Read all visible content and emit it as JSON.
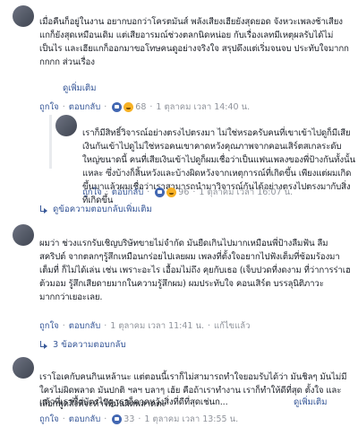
{
  "comments": [
    {
      "id": "c1",
      "text_before": "",
      "text": "เมื่อคืนก็อยู่ในงาน อยากบอกว่าโครตมันส์ พลังเสียงเฮียยังสุดยอด จังหวะเพลงช้าเสียงแกก็ยังสุดเหมือนเดิม แต่เสียอารมณ์ช่วงตลกนิดหน่อย กับเรื่องเลทมีเหตุผลรับได้ไม่เป็นไร และเฮียแกก็ออกมาขอโทษคนดูอย่างจริงใจ สรุปดึงแต่เริ่มจนจบ ประทับใจมากกกกกก ส่วนเรื่อง",
      "see_more": "ดูเพิ่มเติม",
      "like": "ถูกใจ",
      "reply": "ตอบกลับ",
      "reaction_count": "68",
      "time": "1 ตุลาคม เวลา 14:40 น."
    },
    {
      "id": "r1",
      "text": "เราก็มีสิทธิ์วิจารณ์อย่างตรงไปตรงมา ไม่ใช่หรอครับคนที่เขาเข้าไปดูก็มีเสียเงินกันเข้าไปดูไม่ใช่หรอคนเขาคาดหวังคุณภาพจากคอนเสิร์ตสเกลระดับใหญ่ขนาดนี้ คนที่เสียเงินเข้าไปดูก็ผมเชื่อว่าเป็นแฟนเพลงของพี่ป้างกันทั้งนั้นแหละ ซึ่งบ้างก็สิ้นหวังและบ้างผิดหวังจากเหตุการณ์ที่เกิดขึ้น เพียงแต่ผมเกิดขึ้นมาแล้วผมเชื่อว่าเราสามารถนำมาวิจารณ์กันได้อย่างตรงไปตรงมากับสิ่งที่เกิดขึ้น",
      "like": "ถูกใจ",
      "reply": "ตอบกลับ",
      "reaction_count": "96",
      "time": "1 ตุลาคม เวลา 16:07 น."
    },
    {
      "id": "c2",
      "replies_link": "ดูข้อความตอบกลับเพิ่มเติม"
    },
    {
      "id": "c3",
      "text": "ผมว่า ช่วงแรกรับเชิญบริษัทขายไม่จำกัด มันยืดเกินไปมากเหมือนพี่ป้างลืมฟัน ลืมสคริปต์ จากตลกๆรู้สึกเหมือนกร่อยไปเลยผม เพลงที่ตั้งใจอยากไปฟังเต็มที่ซ้อมร้องมาเต็มที่ ก็ไม่ได้เล่น เช่น เพราะอะไร เอื้อมไม่ถึง คุยกับเธอ (เจ็บปวดที่งดงาม ที่ว่าการร่าเฮ ต้วมอม รู้สึกเสียดายมากในความรู้สึกผม) ผมประทับใจ คอนเสิร์ต บรรลุนิติภาวะมากกว่าเยอะเลย.",
      "like": "ถูกใจ",
      "reply": "ตอบกลับ",
      "reaction_count": "",
      "time": "1 ตุลาคม เวลา 11:41 น.",
      "edited": "แก้ไขแล้ว",
      "replies_link": "3 ข้อความตอบกลับ"
    },
    {
      "id": "c4",
      "text": "เราโอเคกับคนกินเหล้านะ แต่ตอนนี้เราก็ไม่สามารถทำใจยอมรับได้ว่า มันชิลๆ มันไม่มีใครไม่ผิดพลาด มันปกติ ฯลฯ บลาๆ เฮ้ย คือถ้าเราทำงาน เราก็ทำให้ดีที่สุด ตั้งใจ และเลือกพูดสิ่งที่จะทำให้มันผิดพลาดตะ",
      "text2": "แล้วที่เราซื้อบัตรไปดู เราก็คาดหวังสิ่งที่ดีที่สุดเช่นก...",
      "see_more": "ดูเพิ่มเติม",
      "like": "ถูกใจ",
      "reply": "ตอบกลับ",
      "reaction_count": "33",
      "time": "1 ตุลาคม เวลา 13:55 น."
    }
  ],
  "colors": {
    "link": "#385898",
    "muted": "#90949c",
    "like_badge": "#4267b2",
    "haha_badge": "#f7b125"
  }
}
